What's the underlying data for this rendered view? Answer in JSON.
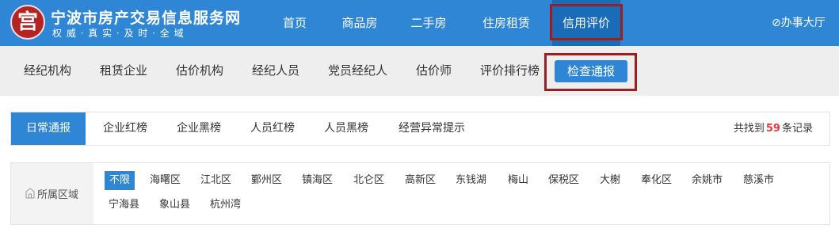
{
  "header": {
    "logo_glyph": "宫",
    "site_title": "宁波市房产交易信息服务网",
    "slogan": "权 威 · 真 实 · 及 时 · 全 域",
    "nav": [
      {
        "label": "首页"
      },
      {
        "label": "商品房"
      },
      {
        "label": "二手房"
      },
      {
        "label": "住房租赁"
      },
      {
        "label": "信用评价",
        "active": true
      }
    ],
    "office_label": "⊘办事大厅"
  },
  "subnav": {
    "items": [
      {
        "label": "经纪机构"
      },
      {
        "label": "租赁企业"
      },
      {
        "label": "估价机构"
      },
      {
        "label": "经纪人员"
      },
      {
        "label": "党员经纪人"
      },
      {
        "label": "估价师"
      },
      {
        "label": "评价排行榜"
      }
    ],
    "active_label": "检查通报"
  },
  "tabs": {
    "items": [
      {
        "label": "日常通报",
        "active": true
      },
      {
        "label": "企业红榜"
      },
      {
        "label": "企业黑榜"
      },
      {
        "label": "人员红榜"
      },
      {
        "label": "人员黑榜"
      },
      {
        "label": "经营异常提示"
      }
    ],
    "result_prefix": "共找到",
    "result_count": "59",
    "result_suffix": "条记录"
  },
  "filter": {
    "label": "所属区域",
    "areas": [
      "不限",
      "海曙区",
      "江北区",
      "鄞州区",
      "镇海区",
      "北仑区",
      "高新区",
      "东钱湖",
      "梅山",
      "保税区",
      "大榭",
      "奉化区",
      "余姚市",
      "慈溪市",
      "宁海县",
      "象山县",
      "杭州湾"
    ]
  },
  "colors": {
    "primary": "#2f86d4",
    "highlight": "#a11d1d",
    "count": "#e23c3c"
  }
}
